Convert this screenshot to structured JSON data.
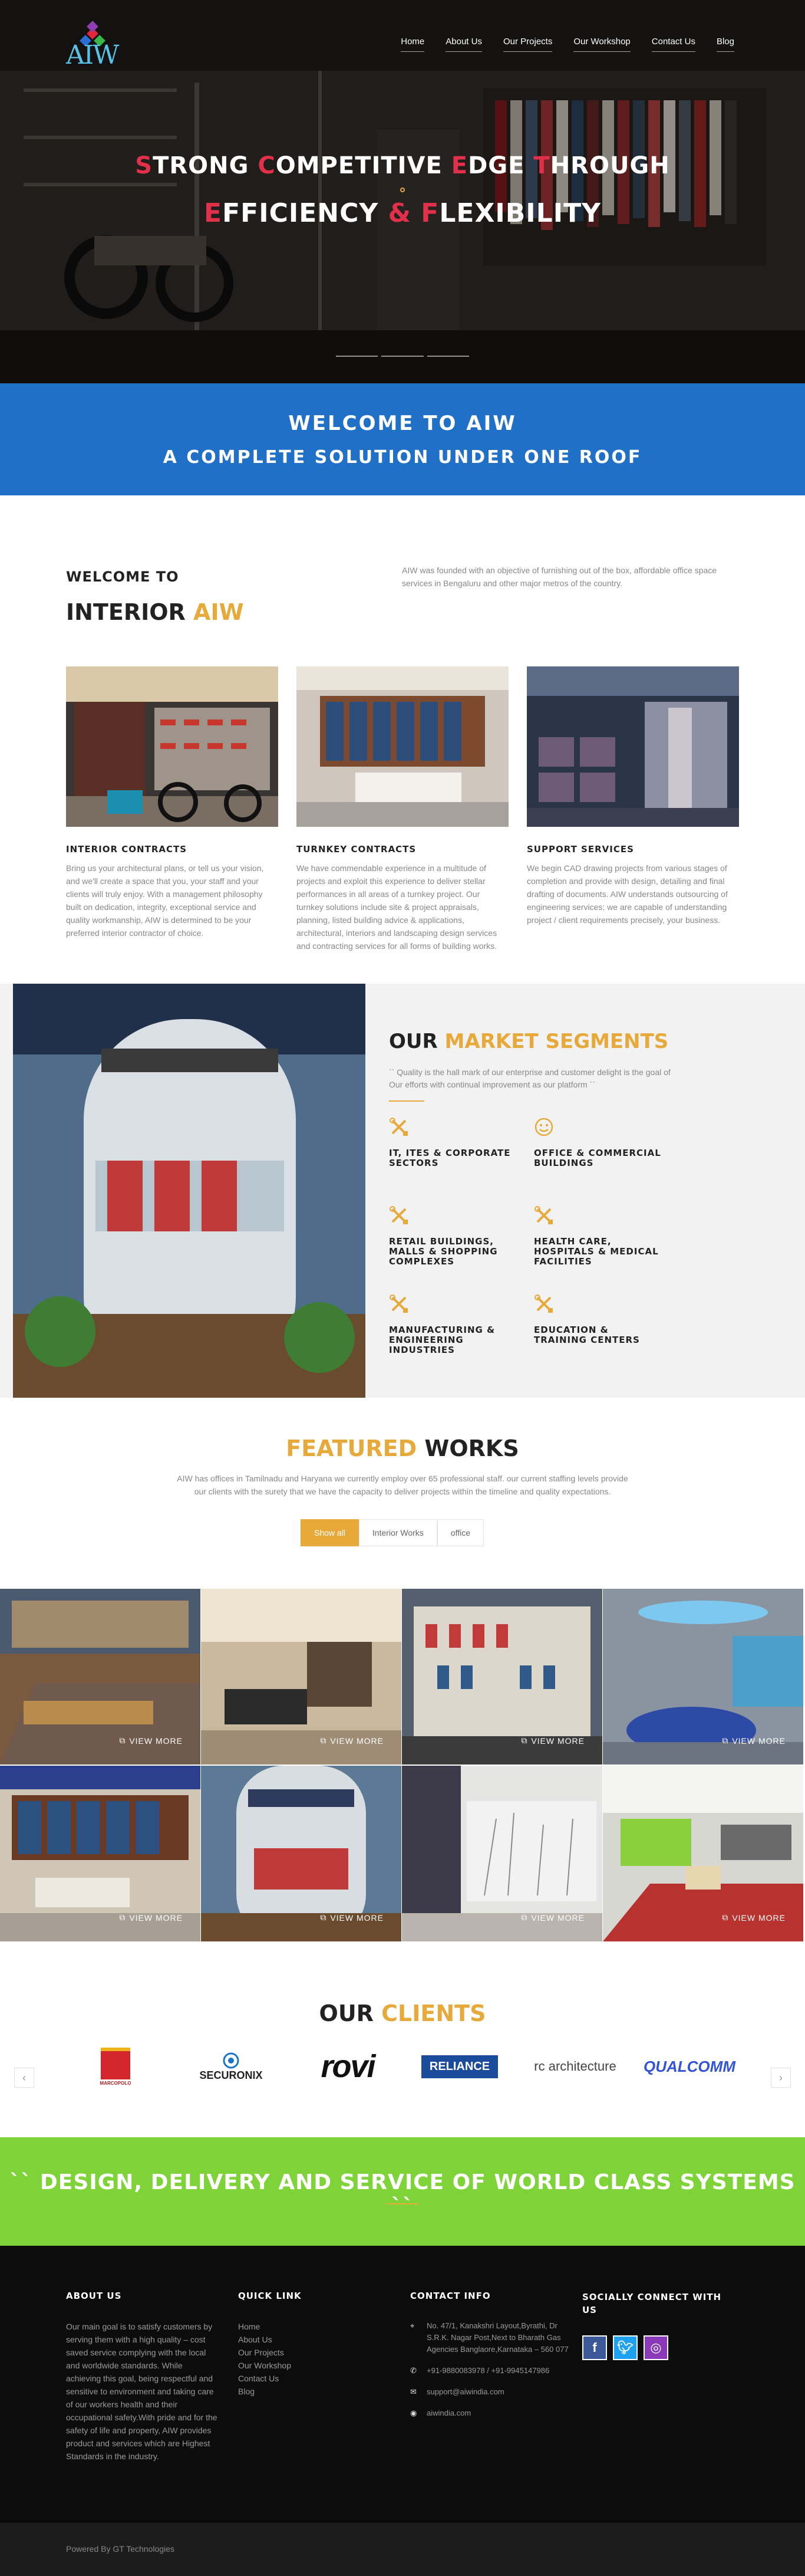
{
  "site": {
    "logo_text": "AIW"
  },
  "nav": [
    {
      "label": "Home"
    },
    {
      "label": "About Us"
    },
    {
      "label": "Our Projects"
    },
    {
      "label": "Our Workshop"
    },
    {
      "label": "Contact Us"
    },
    {
      "label": "Blog"
    }
  ],
  "hero": {
    "line1": [
      {
        "cap": "S",
        "rest": "TRONG "
      },
      {
        "cap": "C",
        "rest": "OMPETITIVE "
      },
      {
        "cap": "E",
        "rest": "DGE "
      },
      {
        "cap": "T",
        "rest": "HROUGH"
      }
    ],
    "line2": [
      {
        "cap": "E",
        "rest": "FFICIENCY "
      },
      {
        "cap": "&",
        "rest": " "
      },
      {
        "cap": "F",
        "rest": "LEXIBILITY"
      }
    ]
  },
  "band": {
    "line1": "WELCOME TO AIW",
    "line2": "A COMPLETE SOLUTION UNDER ONE ROOF"
  },
  "intro": {
    "welcome": "WELCOME TO",
    "title_main": "INTERIOR",
    "title_accent": "AIW",
    "text": "AIW was founded with an objective of furnishing out of the box, affordable office space services in Bengaluru and other major metros of the country."
  },
  "services": [
    {
      "title": "INTERIOR CONTRACTS",
      "text": "Bring us your architectural plans, or tell us your vision, and we'll create a space that you, your staff and your clients will truly enjoy. With a management philosophy built on dedication, integrity, exceptional service and quality workmanship, AIW is determined to be your preferred interior contractor of choice."
    },
    {
      "title": "TURNKEY CONTRACTS",
      "text": "We have commendable experience in a multitude of projects and exploit this experience to deliver stellar performances in all areas of a turnkey project. Our turnkey solutions include site & project appraisals, planning, listed building advice & applications, architectural, interiors and landscaping design services and contracting services for all forms of building works."
    },
    {
      "title": "SUPPORT SERVICES",
      "text": "We begin CAD drawing projects from various stages of completion and provide with design, detailing and final drafting of documents. AIW understands outsourcing of engineering services; we are capable of understanding project / client requirements precisely, your business."
    }
  ],
  "market": {
    "title_main": "OUR",
    "title_accent": "MARKET SEGMENTS",
    "quote": "`` Quality is the hall mark of our enterprise and customer delight is the goal of Our efforts with continual improvement as our platform ``",
    "segments": [
      {
        "label": "IT, ITES & CORPORATE SECTORS",
        "icon": "tools-icon"
      },
      {
        "label": "OFFICE & COMMERCIAL BUILDINGS",
        "icon": "smile-icon"
      },
      {
        "label": "RETAIL BUILDINGS, MALLS & SHOPPING COMPLEXES",
        "icon": "tools-icon"
      },
      {
        "label": "HEALTH CARE, HOSPITALS & MEDICAL FACILITIES",
        "icon": "tools-icon"
      },
      {
        "label": "MANUFACTURING & ENGINEERING INDUSTRIES",
        "icon": "tools-icon"
      },
      {
        "label": "EDUCATION & TRAINING CENTERS",
        "icon": "tools-icon"
      }
    ]
  },
  "featured": {
    "title_accent": "FEATURED",
    "title_main": "WORKS",
    "text": "AIW has offices in Tamilnadu and Haryana we currently employ over 65 professional staff. our current staffing levels provide our clients with the surety that we have the capacity to deliver projects within the timeline and quality expectations.",
    "filters": [
      "Show all",
      "Interior Works",
      "office"
    ],
    "view_more": "VIEW MORE"
  },
  "clients": {
    "title_main": "OUR",
    "title_accent": "CLIENTS",
    "logos": [
      "MARCOPOLO",
      "SECURONIX",
      "rovi",
      "RELIANCE",
      "rc architecture",
      "QUALCOMM"
    ]
  },
  "slogan": "`` DESIGN, DELIVERY AND SERVICE OF WORLD CLASS SYSTEMS ``",
  "footer": {
    "about_title": "ABOUT US",
    "about_text": "Our main goal is to satisfy customers by serving them with a high quality – cost saved service complying with the local and worldwide standards. While achieving this goal, being respectful and sensitive to environment and taking care of our workers health and their occupational safety.With pride and for the safety of life and property, AIW provides product and services which are Highest Standards in the industry.",
    "links_title": "QUICK LINK",
    "links": [
      "Home",
      "About Us",
      "Our Projects",
      "Our Workshop",
      "Contact Us",
      "Blog"
    ],
    "contact_title": "CONTACT INFO",
    "address": "No. 47/1, Kanakshri Layout,Byrathi, Dr S.R.K. Nagar Post,Next to Bharath Gas Agencies Banglaore,Karnataka – 560 077",
    "phone": "+91-9880083978 / +91-9945147986",
    "email": "support@aiwindia.com",
    "web": "aiwindia.com",
    "social_title": "SOCIALLY CONNECT WITH US",
    "copyright": "Powered By GT Technologies"
  }
}
